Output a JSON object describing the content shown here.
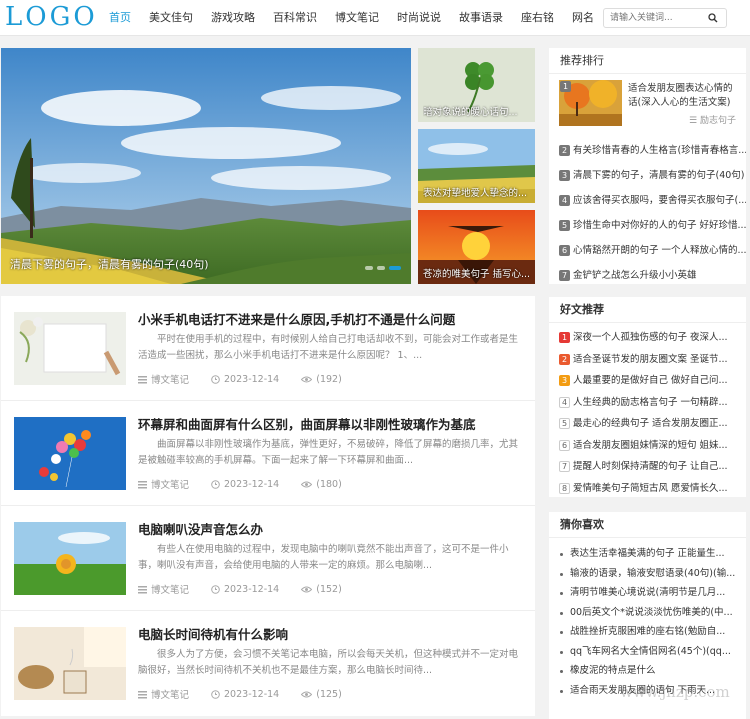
{
  "header": {
    "logo": "LOGO",
    "nav": [
      "首页",
      "美文佳句",
      "游戏攻略",
      "百科常识",
      "博文笔记",
      "时尚说说",
      "故事语录",
      "座右铭",
      "网名"
    ],
    "search_placeholder": "请输入关键词..."
  },
  "slider": {
    "main_caption": "清晨下雾的句子，清晨有雾的句子(40句)",
    "thumbs": [
      "暗对象说的暖心话句...",
      "表达对挚地爱人挚念的...",
      "苍凉的唯美句子 插写心..."
    ]
  },
  "articles": [
    {
      "title": "小米手机电话打不进来是什么原因,手机打不通是什么问题",
      "excerpt": "平时在使用手机的过程中，有时候别人给自己打电话却收不到，可能会对工作或者是生活造成一些困扰，那么小米手机电话打不进来是什么原因呢？ 1、...",
      "category": "博文笔记",
      "date": "2023-12-14",
      "views": "(192)"
    },
    {
      "title": "环幕屏和曲面屏有什么区别，曲面屏幕以非刚性玻璃作为基底",
      "excerpt": "曲面屏幕以非刚性玻璃作为基底，弹性更好，不易破碎，降低了屏幕的磨损几率，尤其是被触碰率较高的手机屏幕。下面一起来了解一下环幕屏和曲面...",
      "category": "博文笔记",
      "date": "2023-12-14",
      "views": "(180)"
    },
    {
      "title": "电脑喇叭没声音怎么办",
      "excerpt": "有些人在使用电脑的过程中，发现电脑中的喇叭竟然不能出声音了，这可不是一件小事，喇叭没有声音，会给使用电脑的人带来一定的麻烦。那么电脑喇...",
      "category": "博文笔记",
      "date": "2023-12-14",
      "views": "(152)"
    },
    {
      "title": "电脑长时间待机有什么影响",
      "excerpt": "很多人为了方便，会习惯不关笔记本电脑，所以会每天关机，但这种模式并不一定对电脑很好，当然长时间待机不关机也不是最佳方案，那么电脑长时间待...",
      "category": "博文笔记",
      "date": "2023-12-14",
      "views": "(125)"
    }
  ],
  "ranking": {
    "title": "推荐排行",
    "top": {
      "num": "1",
      "title": "适合发朋友圈表达心情的话(深入人心的生活文案)",
      "category": "励志句子"
    },
    "rows": [
      {
        "num": "2",
        "text": "有关珍惜青春的人生格言(珍惜青春格言..."
      },
      {
        "num": "3",
        "text": "清晨下雾的句子，清晨有雾的句子(40句)"
      },
      {
        "num": "4",
        "text": "应该舍得买衣服吗，要舍得买衣服句子(..."
      },
      {
        "num": "5",
        "text": "珍惜生命中对你好的人的句子 好好珍惜..."
      },
      {
        "num": "6",
        "text": "心情豁然开朗的句子 一个人释放心情的..."
      },
      {
        "num": "7",
        "text": "金铲铲之战怎么升级小小英雄"
      }
    ]
  },
  "friends": {
    "title": "好文推荐",
    "rows": [
      {
        "num": "1",
        "text": "深夜一个人孤独伤感的句子 夜深人..."
      },
      {
        "num": "2",
        "text": "适合圣诞节发的朋友圈文案 圣诞节..."
      },
      {
        "num": "3",
        "text": "人最重要的是做好自己 做好自己问..."
      },
      {
        "num": "4",
        "text": "人生经典的励志格言句子 一句精辟..."
      },
      {
        "num": "5",
        "text": "最走心的经典句子 适合发朋友圈正..."
      },
      {
        "num": "6",
        "text": "适合发朋友圈姐妹情深的短句 姐妹..."
      },
      {
        "num": "7",
        "text": "提醒人时刻保持清醒的句子 让自己..."
      },
      {
        "num": "8",
        "text": "爱情唯美句子简短古风 愿爱情长久..."
      }
    ]
  },
  "guess": {
    "title": "猜你喜欢",
    "rows": [
      "表达生活幸福美满的句子 正能量生...",
      "输液的语录，输液安慰语录(40句)(输...",
      "清明节唯美心境说说(清明节是几月...",
      "00后英文个*说说淡淡忧伤唯美的(中...",
      "战胜挫折克服困难的座右铭(勉励自...",
      "qq飞车网名大全情侣网名(45个)(qq...",
      "橡皮泥的特点是什么",
      "适合雨天发朋友圈的语句 下雨天..."
    ]
  },
  "watermark": "www.jhzp.com",
  "colors": {
    "accent": "#1c9bd6",
    "rank1": "#e53935",
    "rank3": "#f39c12"
  }
}
